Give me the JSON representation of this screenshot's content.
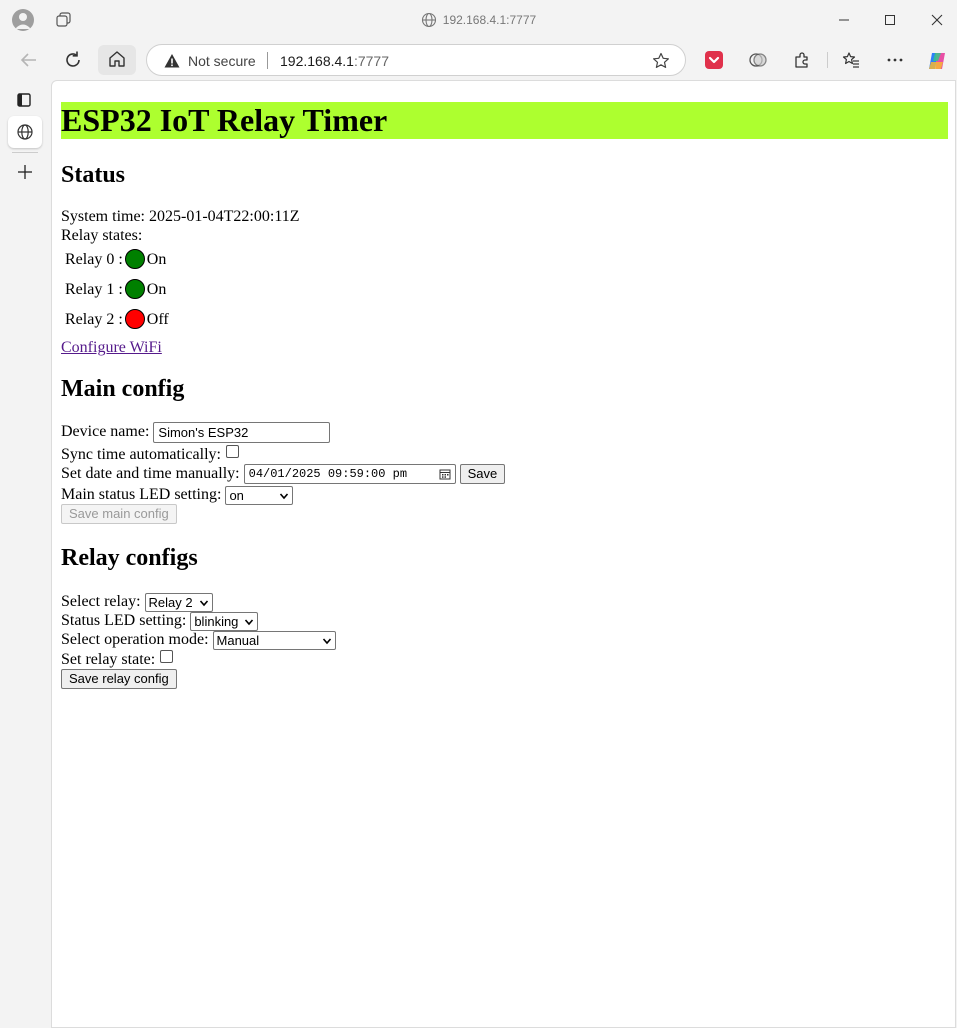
{
  "browser": {
    "title_url": "192.168.4.1:7777",
    "security_label": "Not secure",
    "address_host": "192.168.4.1",
    "address_port": ":7777"
  },
  "page": {
    "heading": "ESP32 IoT Relay Timer",
    "heading_bg": "#adff2f",
    "status": {
      "heading": "Status",
      "system_time_label": "System time:",
      "system_time_value": "2025-01-04T22:00:11Z",
      "relay_states_label": "Relay states:",
      "relays": [
        {
          "label": "Relay 0 :",
          "state": "On",
          "color": "#008000"
        },
        {
          "label": "Relay 1 :",
          "state": "On",
          "color": "#008000"
        },
        {
          "label": "Relay 2 :",
          "state": "Off",
          "color": "#ff0000"
        }
      ],
      "configure_wifi_link": "Configure WiFi"
    },
    "main_config": {
      "heading": "Main config",
      "device_name_label": "Device name:",
      "device_name_value": "Simon's ESP32",
      "sync_time_label": "Sync time automatically:",
      "sync_time_checked": false,
      "set_datetime_label": "Set date and time manually:",
      "datetime_value": "04/01/2025 09:59:00 pm",
      "save_button": "Save",
      "led_setting_label": "Main status LED setting:",
      "led_setting_value": "on",
      "save_main_button": "Save main config"
    },
    "relay_configs": {
      "heading": "Relay configs",
      "select_relay_label": "Select relay:",
      "select_relay_value": "Relay 2",
      "status_led_label": "Status LED setting:",
      "status_led_value": "blinking",
      "operation_mode_label": "Select operation mode:",
      "operation_mode_value": "Manual",
      "relay_state_label": "Set relay state:",
      "relay_state_checked": false,
      "save_relay_button": "Save relay config"
    }
  }
}
